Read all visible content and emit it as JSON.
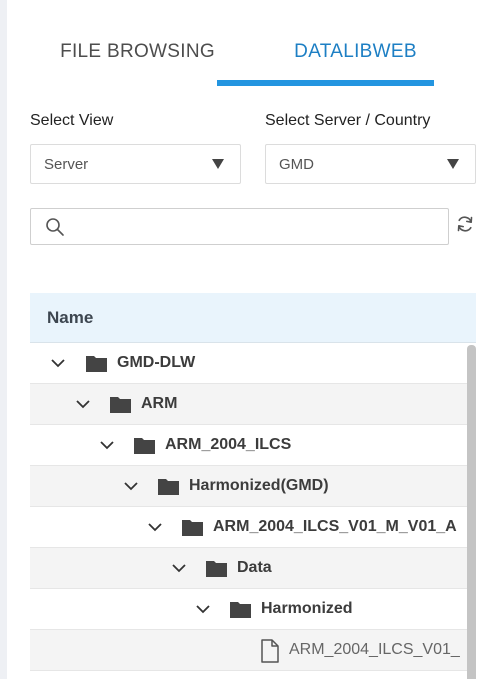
{
  "tabs": {
    "file_browsing": "FILE BROWSING",
    "datalibweb": "DATALIBWEB",
    "active": "datalibweb"
  },
  "filters": {
    "view_label": "Select View",
    "view_value": "Server",
    "server_label": "Select Server / Country",
    "server_value": "GMD"
  },
  "search": {
    "value": ""
  },
  "grid": {
    "column_name": "Name",
    "rows": [
      {
        "label": "GMD-DLW",
        "type": "folder",
        "expanded": true,
        "level": 0
      },
      {
        "label": "ARM",
        "type": "folder",
        "expanded": true,
        "level": 1
      },
      {
        "label": "ARM_2004_ILCS",
        "type": "folder",
        "expanded": true,
        "level": 2
      },
      {
        "label": "Harmonized(GMD)",
        "type": "folder",
        "expanded": true,
        "level": 3
      },
      {
        "label": "ARM_2004_ILCS_V01_M_V01_A",
        "type": "folder",
        "expanded": true,
        "level": 4
      },
      {
        "label": "Data",
        "type": "folder",
        "expanded": true,
        "level": 5
      },
      {
        "label": "Harmonized",
        "type": "folder",
        "expanded": true,
        "level": 6
      },
      {
        "label": "ARM_2004_ILCS_V01_",
        "type": "file",
        "level": 7
      }
    ]
  },
  "colors": {
    "accent": "#2395e0",
    "accent_text": "#1d7fc4",
    "header_bg": "#e9f4fc",
    "alt_row_bg": "#f4f4f4"
  }
}
